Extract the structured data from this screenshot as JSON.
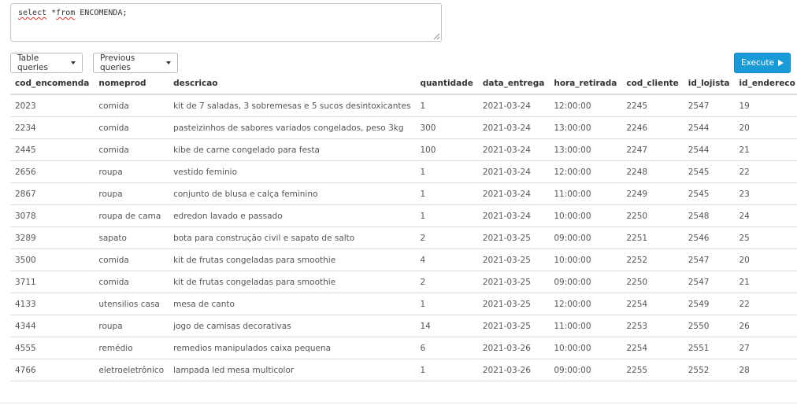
{
  "editor": {
    "query_prefix": "select",
    "query_rest_1": " *",
    "query_from": "from",
    "query_rest_2": " ENCOMENDA;"
  },
  "toolbar": {
    "table_queries_label": "Table queries",
    "previous_queries_label": "Previous queries",
    "execute_label": "Execute",
    "execute_color": "#1a9ad6"
  },
  "table": {
    "columns": [
      "cod_encomenda",
      "nomeprod",
      "descricao",
      "quantidade",
      "data_entrega",
      "hora_retirada",
      "cod_cliente",
      "id_lojista",
      "id_endereco"
    ],
    "rows": [
      [
        "2023",
        "comida",
        "kit de 7 saladas, 3 sobremesas e 5 sucos desintoxicantes",
        "1",
        "2021-03-24",
        "12:00:00",
        "2245",
        "2547",
        "19"
      ],
      [
        "2234",
        "comida",
        "pasteizinhos de sabores variados congelados, peso 3kg",
        "300",
        "2021-03-24",
        "13:00:00",
        "2246",
        "2544",
        "20"
      ],
      [
        "2445",
        "comida",
        "kibe de carne congelado para festa",
        "100",
        "2021-03-24",
        "13:00:00",
        "2247",
        "2544",
        "21"
      ],
      [
        "2656",
        "roupa",
        "vestido feminio",
        "1",
        "2021-03-24",
        "12:00:00",
        "2248",
        "2545",
        "22"
      ],
      [
        "2867",
        "roupa",
        "conjunto de blusa e calça feminino",
        "1",
        "2021-03-24",
        "11:00:00",
        "2249",
        "2545",
        "23"
      ],
      [
        "3078",
        "roupa de cama",
        "edredon lavado e passado",
        "1",
        "2021-03-24",
        "10:00:00",
        "2250",
        "2548",
        "24"
      ],
      [
        "3289",
        "sapato",
        "bota para construção civil e sapato de salto",
        "2",
        "2021-03-25",
        "09:00:00",
        "2251",
        "2546",
        "25"
      ],
      [
        "3500",
        "comida",
        "kit de frutas congeladas para smoothie",
        "4",
        "2021-03-25",
        "10:00:00",
        "2252",
        "2547",
        "20"
      ],
      [
        "3711",
        "comida",
        "kit de frutas congeladas para smoothie",
        "2",
        "2021-03-25",
        "09:00:00",
        "2250",
        "2547",
        "21"
      ],
      [
        "4133",
        "utensilios casa",
        "mesa de canto",
        "1",
        "2021-03-25",
        "12:00:00",
        "2254",
        "2549",
        "22"
      ],
      [
        "4344",
        "roupa",
        "jogo de camisas decorativas",
        "14",
        "2021-03-25",
        "11:00:00",
        "2253",
        "2550",
        "26"
      ],
      [
        "4555",
        "remédio",
        "remedios manipulados caixa pequena",
        "6",
        "2021-03-26",
        "10:00:00",
        "2254",
        "2551",
        "27"
      ],
      [
        "4766",
        "eletroeletrônico",
        "lampada led mesa multicolor",
        "1",
        "2021-03-26",
        "09:00:00",
        "2255",
        "2552",
        "28"
      ]
    ]
  }
}
